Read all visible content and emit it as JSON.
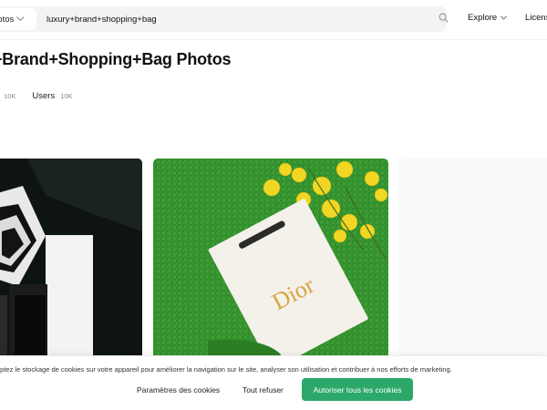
{
  "header": {
    "type_select": "hotos",
    "search_value": "luxury+brand+shopping+bag",
    "nav": {
      "explore": "Explore",
      "license": "Licens"
    }
  },
  "page": {
    "title": "+Brand+Shopping+Bag Photos",
    "tabs": [
      {
        "label": "os",
        "count": "10K"
      },
      {
        "label": "Users",
        "count": "10K"
      }
    ]
  },
  "photos": [
    {
      "subject": "black and white shopping bags on dark background"
    },
    {
      "subject": "white Dior shopping bag on green grass with yellow flowers",
      "brand_text": "Dior"
    },
    {
      "subject": "loading placeholder"
    }
  ],
  "cookie_banner": {
    "text": "eptez le stockage de cookies sur votre appareil pour améliorer la navigation sur le site, analyser son utilisation et contribuer à nos efforts de marketing.",
    "settings_label": "Paramètres des cookies",
    "refuse_label": "Tout refuser",
    "accept_label": "Autoriser tous les cookies",
    "accept_color": "#2ca86a"
  },
  "icons": {
    "search": "search-icon",
    "type_chevron": "chevron-down-icon",
    "explore_chevron": "chevron-down-icon"
  }
}
